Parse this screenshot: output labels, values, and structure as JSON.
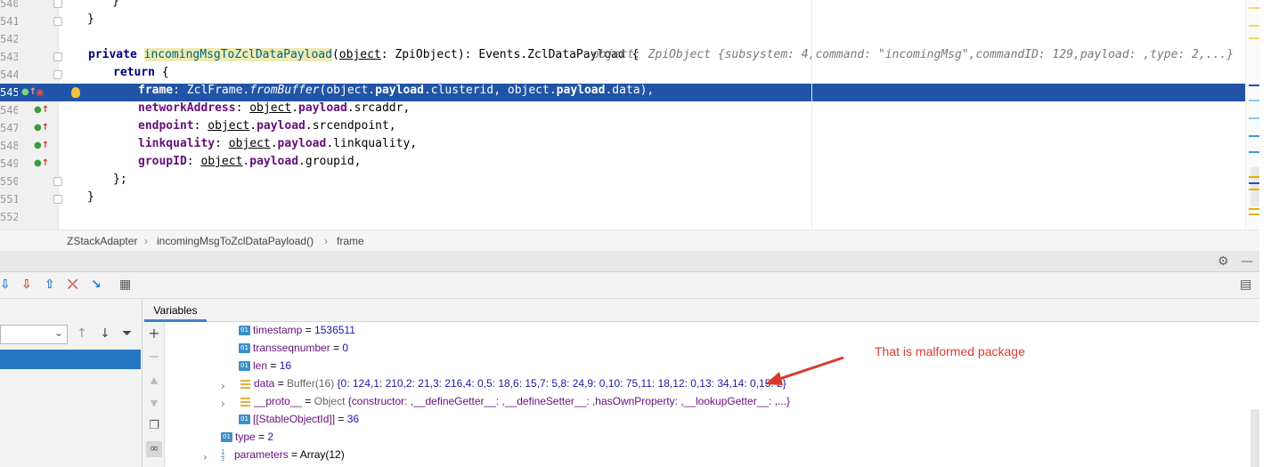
{
  "editor": {
    "line_numbers": [
      "540",
      "541",
      "542",
      "543",
      "544",
      "545",
      "546",
      "547",
      "548",
      "549",
      "550",
      "551",
      "552"
    ],
    "method_decl": {
      "kw_private": "private",
      "name": "incomingMsgToZclDataPayload",
      "paren_open": "(",
      "param": "object",
      "sig_rest": ": ZpiObject): Events.ZclDataPayload {",
      "inline_hint": "object: ZpiObject {subsystem: 4,command: \"incomingMsg\",commandID: 129,payload: ,type: 2,...}"
    },
    "close_brace_1": "}",
    "close_brace_2": "}",
    "return_kw": "return",
    "return_brace": " {",
    "frame_line": {
      "key": "frame",
      "pre": ": ZclFrame.",
      "method": "fromBuffer",
      "a1_obj": "(object.",
      "a1_p1": "payload",
      "a1_dot": ".",
      "a1_p2": "clusterid",
      "sep": ", object.",
      "a2_p1": "payload",
      "a2_dot": ".",
      "a2_p2": "data",
      "end": "),"
    },
    "props": [
      {
        "key": "networkAddress",
        "obj": "object",
        "path": "payload",
        "field": "srcaddr"
      },
      {
        "key": "endpoint",
        "obj": "object",
        "path": "payload",
        "field": "srcendpoint"
      },
      {
        "key": "linkquality",
        "obj": "object",
        "path": "payload",
        "field": "linkquality"
      },
      {
        "key": "groupID",
        "obj": "object",
        "path": "payload",
        "field": "groupid"
      }
    ],
    "close_return": "};",
    "close_method": "}",
    "gutter_top_brace": "}"
  },
  "breadcrumb": [
    "ZStackAdapter",
    "incomingMsgToZclDataPayload()",
    "frame"
  ],
  "debug": {
    "tab_label": "Variables"
  },
  "variables": {
    "timestamp": {
      "name": "timestamp",
      "value": "1536511"
    },
    "transseqnumber": {
      "name": "transseqnumber",
      "value": "0"
    },
    "len": {
      "name": "len",
      "value": "16"
    },
    "data": {
      "name": "data",
      "type": "Buffer(16)",
      "value": "{0: 124,1: 210,2: 21,3: 216,4: 0,5: 18,6: 15,7: 5,8: 24,9: 0,10: 75,11: 18,12: 0,13: 34,14: 0,15: 2}"
    },
    "proto": {
      "name": "__proto__",
      "type": "Object",
      "value": "{constructor: ,__defineGetter__: ,__defineSetter__: ,hasOwnProperty: ,__lookupGetter__: ,...}"
    },
    "stable": {
      "name": "[[StableObjectId]]",
      "value": "36"
    },
    "type": {
      "name": "type",
      "value": "2"
    },
    "parameters": {
      "name": "parameters",
      "value": "Array(12)"
    }
  },
  "annotation": "That is malformed package",
  "colors": {
    "selection": "#2154a6",
    "keyword": "#000080",
    "property": "#660e7a",
    "annotation": "#d93a2f",
    "number": "#1a1aa6"
  },
  "icons": [
    "fold-icon",
    "override-icon",
    "breakpoint-icon",
    "bulb-icon",
    "gear-icon",
    "minimize-icon",
    "step-over-icon",
    "step-into-icon",
    "step-out-icon",
    "drop-frame-icon",
    "run-to-cursor-icon",
    "evaluate-icon",
    "layout-icon",
    "add-watch-icon",
    "copy-icon",
    "glasses-icon"
  ]
}
